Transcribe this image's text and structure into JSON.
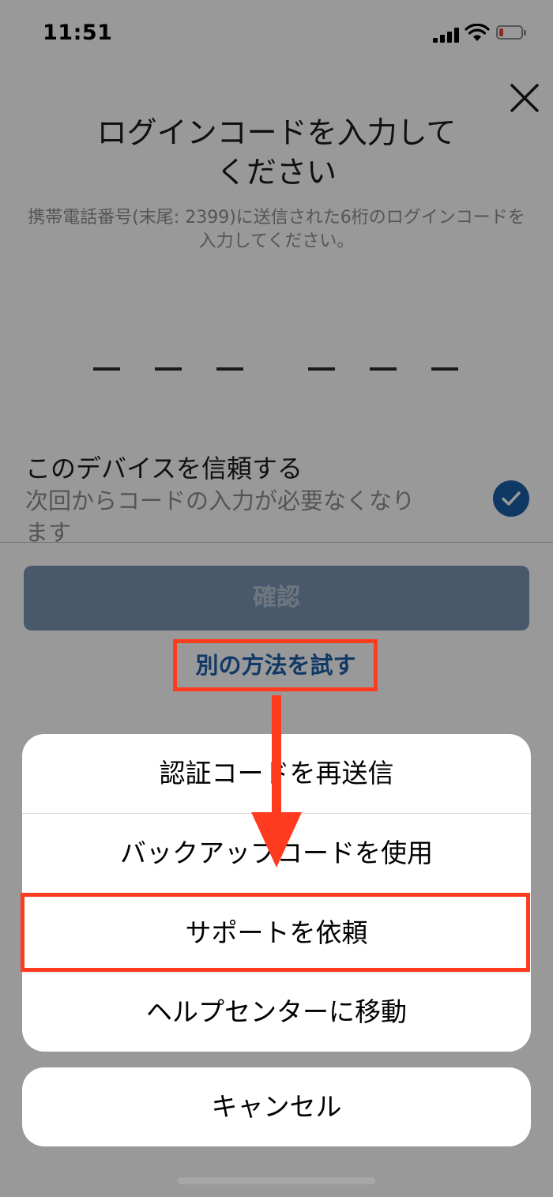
{
  "status_bar": {
    "time": "11:51",
    "battery_color": "#e5483b"
  },
  "header": {
    "close_icon": "close-icon",
    "title": "ログインコードを入力して\nください",
    "subtitle": "携帯電話番号(末尾: 2399)に送信された6桁のログインコードを入力してください。"
  },
  "code_input": {
    "slots": 6
  },
  "trust_device": {
    "title": "このデバイスを信頼する",
    "description": "次回からコードの入力が必要なくなります",
    "checked": true
  },
  "confirm_button": {
    "label": "確認",
    "enabled": false
  },
  "alt_link": {
    "label": "別の方法を試す"
  },
  "action_sheet": {
    "items": [
      {
        "label": "認証コードを再送信"
      },
      {
        "label": "バックアップコードを使用"
      },
      {
        "label": "サポートを依頼"
      },
      {
        "label": "ヘルプセンターに移動"
      }
    ],
    "cancel_label": "キャンセル"
  },
  "annotations": {
    "highlight_color": "#ff3b1f",
    "arrow_color": "#ff3b1f"
  }
}
